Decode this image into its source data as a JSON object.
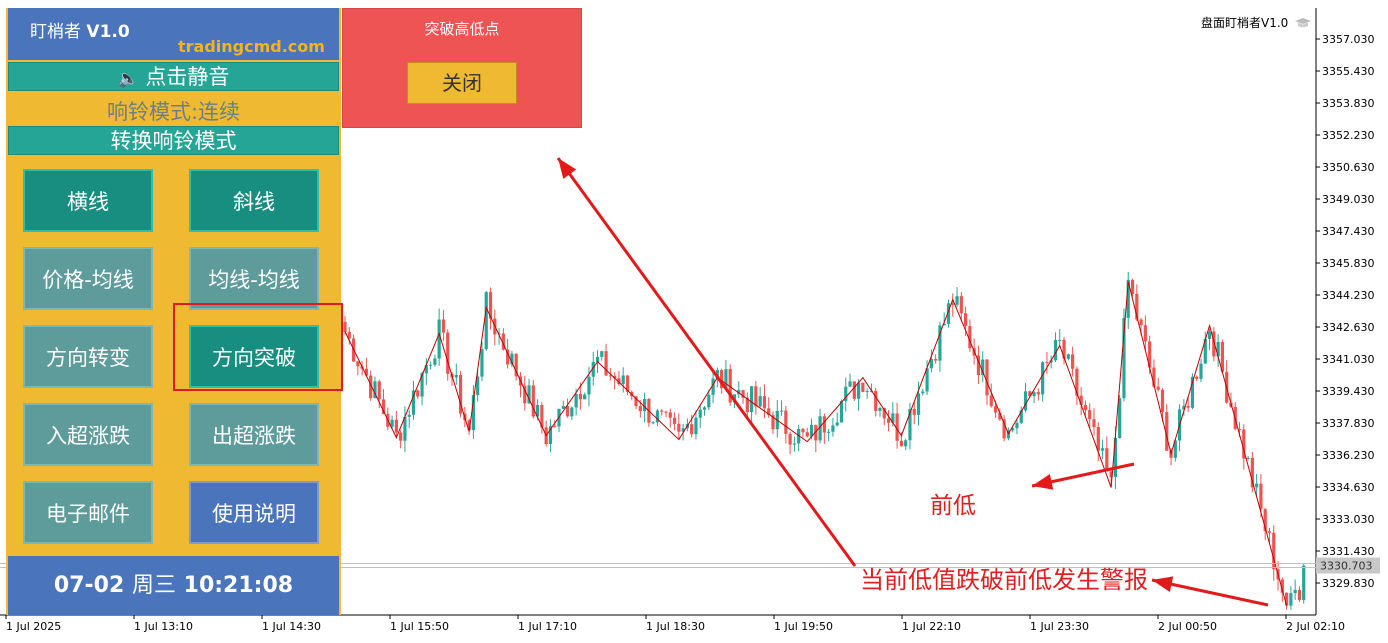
{
  "panel": {
    "title_prefix": "盯梢者",
    "title_version": "V1.0",
    "site": "tradingcmd.com",
    "mute_label": "点击静音",
    "ring_mode": "响铃模式:连续",
    "switch_mode_label": "转换响铃模式",
    "buttons": [
      "横线",
      "斜线",
      "价格-均线",
      "均线-均线",
      "方向转变",
      "方向突破",
      "入超涨跌",
      "出超涨跌",
      "电子邮件",
      "使用说明"
    ],
    "clock": {
      "date": "07-02",
      "weekday": "周三",
      "time": "10:21:08"
    }
  },
  "popup": {
    "title": "突破高低点",
    "close_label": "关闭"
  },
  "indicator_label": "盘面盯梢者V1.0",
  "annotations": {
    "previous_low": "前低",
    "alert_note": "当前低值跌破前低发生警报"
  },
  "colors": {
    "bull": "#26a69a",
    "bear": "#ef5350",
    "zigzag": "#c00000",
    "arrow": "#e41a1a",
    "panel_bg": "#f0b932",
    "header_blue": "#4a74bb"
  },
  "chart_data": {
    "type": "candlestick",
    "symbol_price_current": "3330.703",
    "y_ticks": [
      "3357.030",
      "3355.430",
      "3353.830",
      "3352.230",
      "3350.630",
      "3349.030",
      "3347.430",
      "3345.830",
      "3344.230",
      "3342.630",
      "3341.030",
      "3339.430",
      "3337.830",
      "3336.230",
      "3334.630",
      "3333.030",
      "3331.430",
      "3329.830"
    ],
    "x_ticks": [
      "1 Jul 2025",
      "1 Jul 13:10",
      "1 Jul 14:30",
      "1 Jul 15:50",
      "1 Jul 17:10",
      "1 Jul 18:30",
      "1 Jul 19:50",
      "1 Jul 22:10",
      "1 Jul 23:30",
      "2 Jul 00:50",
      "2 Jul 02:10"
    ],
    "ylim": [
      3328.4,
      3358.5
    ],
    "zigzag": [
      [
        0,
        3342.4
      ],
      [
        12,
        3337.1
      ],
      [
        22,
        3342.3
      ],
      [
        29,
        3337.4
      ],
      [
        33,
        3343.6
      ],
      [
        47,
        3337.2
      ],
      [
        59,
        3340.9
      ],
      [
        78,
        3337.0
      ],
      [
        87,
        3340.1
      ],
      [
        108,
        3336.9
      ],
      [
        121,
        3340.1
      ],
      [
        130,
        3337.2
      ],
      [
        142,
        3344.0
      ],
      [
        155,
        3337.3
      ],
      [
        167,
        3341.7
      ],
      [
        179,
        3334.6
      ],
      [
        183,
        3344.9
      ],
      [
        193,
        3336.3
      ],
      [
        202,
        3342.7
      ],
      [
        220,
        3328.7
      ]
    ],
    "current_price": 3330.703
  }
}
